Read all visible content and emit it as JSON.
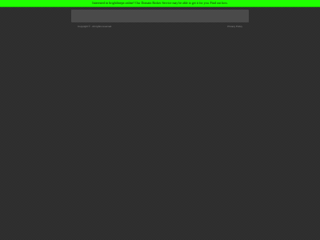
{
  "promo_banner": {
    "message": "Interested in brightlinepe.online? Our Domain Broker Service may be able to get it for you.",
    "link_label": "Find out how.",
    "background_color": "#1fff00"
  },
  "footer": {
    "copyright": "Copyright © . All rights reserved.",
    "privacy_link": "Privacy Policy"
  },
  "page": {
    "background_color": "#333333"
  }
}
